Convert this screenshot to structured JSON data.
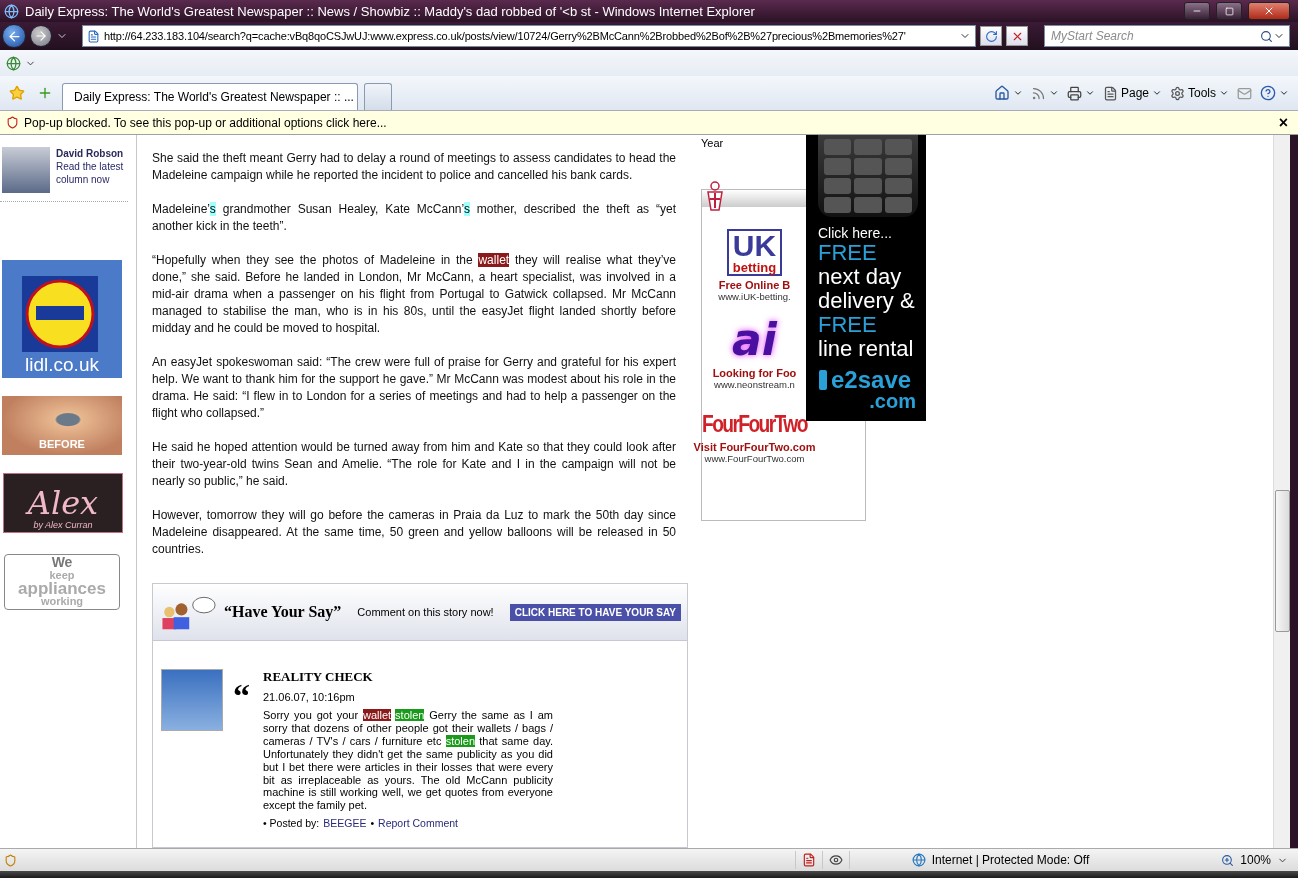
{
  "window": {
    "title": "Daily Express: The World's Greatest Newspaper :: News / Showbiz :: Maddy's dad robbed of '<b st - Windows Internet Explorer"
  },
  "address_bar": {
    "url": "http://64.233.183.104/search?q=cache:vBq8qoCSJwUJ:www.express.co.uk/posts/view/10724/Gerry%2BMcCann%2Brobbed%2Bof%2B%27precious%2Bmemories%27'"
  },
  "search": {
    "placeholder": "MyStart Search"
  },
  "tabs": [
    {
      "label": "Daily Express: The World's Greatest Newspaper :: ...",
      "selected": true
    }
  ],
  "command_bar": [
    "Page",
    "Tools"
  ],
  "info_bar": {
    "message": "Pop-up blocked. To see this pop-up or additional options click here...",
    "close": "×"
  },
  "sidebar": {
    "author": {
      "name": "David Robson",
      "link": "Read the latest column now"
    },
    "ads": [
      {
        "kind": "lidl",
        "text": "lidl.co.uk"
      },
      {
        "kind": "before",
        "text": "BEFORE"
      },
      {
        "kind": "alex",
        "text": "Alex",
        "byline": "by Alex Curran"
      },
      {
        "kind": "appliances",
        "lines": [
          "We",
          "keep",
          "appliances",
          "working"
        ]
      }
    ]
  },
  "article": {
    "paragraphs": [
      [
        {
          "text": "She said the theft meant Gerry had to delay a round of meetings to assess candidates to head the Madeleine campaign while he reported the incident to police and cancelled his bank cards."
        }
      ],
      [
        {
          "text": "Madeleine’"
        },
        {
          "text": "s",
          "color": "#a0ffff"
        },
        {
          "text": " grandmother Susan Healey, Kate McCann’"
        },
        {
          "text": "s",
          "color": "#a0ffff"
        },
        {
          "text": " mother, described the theft as “yet another kick in the teeth”."
        }
      ],
      [
        {
          "text": "“Hopefully when they see the photos of Madeleine in the "
        },
        {
          "text": "wallet",
          "color": "#8b1a1a"
        },
        {
          "text": " they will realise what they’ve done,” she said. Before he landed in London, Mr McCann, a heart specialist, was involved in a mid-air drama when a passenger on his flight from Portugal to Gatwick collapsed. Mr McCann managed to stabilise the man, who is in his 80s, until the easyJet flight landed shortly before midday and he could be moved to hospital."
        }
      ],
      [
        {
          "text": "An easyJet spokeswoman said: “The crew were full of praise for Gerry and grateful for his expert help. We want to thank him for the support he gave.” Mr McCann was modest about his role in the drama. He said: “I flew in to London for a series of meetings and had to help a passenger on the flight who collapsed.”"
        }
      ],
      [
        {
          "text": "He said he hoped attention would be turned away from him and Kate so that they could look after their two-year-old twins Sean and Amelie. “The role for Kate and I in the campaign will not be nearly so public,” he said."
        }
      ],
      [
        {
          "text": "However, tomorrow they will go before the cameras in Praia da Luz to mark the 50th day since Madeleine disappeared. At the same time, 50 green and yellow balloons will be released in 50 countries."
        }
      ]
    ]
  },
  "comments_section": {
    "heading": "“Have Your Say”",
    "prompt": "Comment on this story now!",
    "button": "CLICK HERE TO HAVE YOUR SAY",
    "comments": [
      {
        "quote_mark": "“",
        "title": "REALITY CHECK",
        "date": "21.06.07, 10:16pm",
        "body": [
          {
            "text": "Sorry you got your "
          },
          {
            "text": "wallet",
            "color": "#8b1a1a"
          },
          {
            "text": "stolen",
            "color": "#1a9a1a"
          },
          {
            "text": " Gerry the same as I am sorry that dozens of other people got their wallets / bags / cameras / TV's / cars / furniture etc "
          },
          {
            "text": "stolen",
            "color": "#1a9a1a"
          },
          {
            "text": " that same day. Unfortunately they didn't get the same publicity as you did but I bet there were articles in their losses that were every bit as irreplaceable as yours. The old McCann publicity machine is still working well, we get quotes from everyone except the family pet."
          }
        ],
        "posted_label": "• Posted by:",
        "author": "BEEGEE",
        "separator": "•",
        "report": "Report Comment"
      }
    ]
  },
  "right_column": {
    "caption": "Year",
    "sponsors": [
      {
        "kind": "uk-betting",
        "logo": "UK",
        "logo_sub": "betting",
        "headline": "Free Online B",
        "url": "www.iUK-betting."
      },
      {
        "kind": "neonstream",
        "logo": "ai",
        "headline": "Looking for Foo",
        "url": "www.neonstream.n"
      },
      {
        "kind": "fourfourtwo",
        "logo": "FourFourTwo",
        "headline": "Visit FourFourTwo.com",
        "url": "www.FourFourTwo.com"
      }
    ]
  },
  "phone_ad": {
    "cta": "Click here...",
    "offers": [
      {
        "text": "FREE",
        "highlight": true
      },
      {
        "text": "next day",
        "highlight": false
      },
      {
        "text": "delivery &",
        "highlight": false
      },
      {
        "text": "FREE",
        "highlight": true
      },
      {
        "text": "line rental",
        "highlight": false
      }
    ],
    "brand": "e2save",
    "domain": ".com"
  },
  "status_bar": {
    "zone": "Internet | Protected Mode: Off",
    "zoom": "100%"
  }
}
